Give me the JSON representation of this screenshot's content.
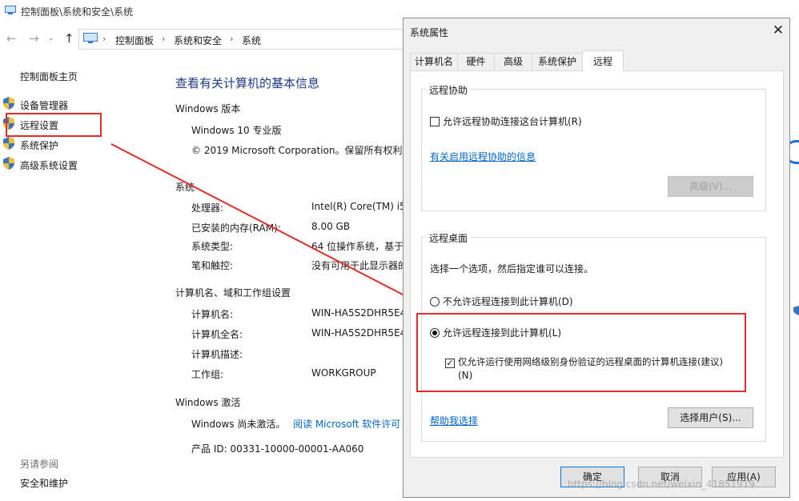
{
  "window": {
    "title": "控制面板\\系统和安全\\系统",
    "breadcrumb": [
      "控制面板",
      "系统和安全",
      "系统"
    ]
  },
  "sidebar": {
    "home": "控制面板主页",
    "items": [
      {
        "label": "设备管理器",
        "icon": "shield-icon"
      },
      {
        "label": "远程设置",
        "icon": "shield-icon"
      },
      {
        "label": "系统保护",
        "icon": "shield-icon"
      },
      {
        "label": "高级系统设置",
        "icon": "shield-icon"
      }
    ],
    "see_also": "另请参阅",
    "see_also_items": [
      "安全和维护"
    ]
  },
  "main": {
    "heading": "查看有关计算机的基本信息",
    "windows_edition": {
      "title": "Windows 版本",
      "edition": "Windows 10 专业版",
      "copyright": "© 2019 Microsoft Corporation。保留所有权利"
    },
    "system": {
      "title": "系统",
      "rows": [
        {
          "label": "处理器:",
          "value": "Intel(R) Core(TM) i5"
        },
        {
          "label": "已安装的内存(RAM):",
          "value": "8.00 GB"
        },
        {
          "label": "系统类型:",
          "value": "64 位操作系统，基于"
        },
        {
          "label": "笔和触控:",
          "value": "没有可用于此显示器的"
        }
      ]
    },
    "computer": {
      "title": "计算机名、域和工作组设置",
      "rows": [
        {
          "label": "计算机名:",
          "value": "WIN-HA5S2DHR5E4"
        },
        {
          "label": "计算机全名:",
          "value": "WIN-HA5S2DHR5E4"
        },
        {
          "label": "计算机描述:",
          "value": ""
        },
        {
          "label": "工作组:",
          "value": "WORKGROUP"
        }
      ]
    },
    "activation": {
      "title": "Windows 激活",
      "status": "Windows 尚未激活。",
      "link": "阅读 Microsoft 软件许可",
      "product_id": "产品 ID: 00331-10000-00001-AA060"
    }
  },
  "dialog": {
    "title": "系统属性",
    "tabs": [
      "计算机名",
      "硬件",
      "高级",
      "系统保护",
      "远程"
    ],
    "active_tab": "远程",
    "remote_assistance": {
      "group_label": "远程协助",
      "checkbox_label": "允许远程协助连接这台计算机(R)",
      "checkbox_checked": false,
      "info_link": "有关启用远程协助的信息",
      "advanced_button": "高级(V)..."
    },
    "remote_desktop": {
      "group_label": "远程桌面",
      "instruction": "选择一个选项，然后指定谁可以连接。",
      "option_disallow": "不允许远程连接到此计算机(D)",
      "option_allow": "允许远程连接到此计算机(L)",
      "selected": "allow",
      "nla_label_line1": "仅允许运行使用网络级别身份验证的远程桌面的计算机连接(建议)",
      "nla_label_line2": "(N)",
      "nla_checked": true,
      "help_link": "帮助我选择",
      "select_users_button": "选择用户(S)..."
    },
    "buttons": {
      "ok": "确定",
      "cancel": "取消",
      "apply": "应用(A)"
    }
  },
  "watermark": "https://blog.csdn.net/weixin_41851919",
  "colors": {
    "heading": "#1e3a8a",
    "link": "#0066cc",
    "annotation": "#e32b2b"
  }
}
